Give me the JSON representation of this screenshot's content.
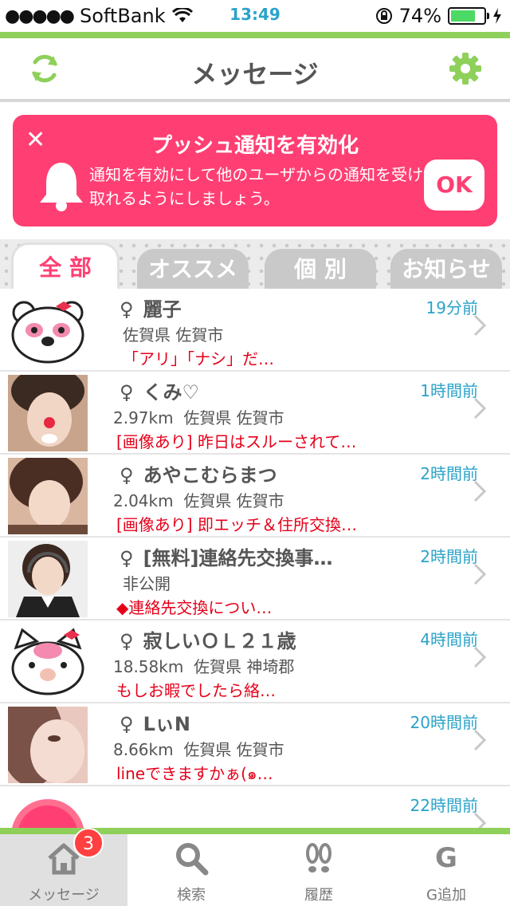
{
  "status": {
    "carrier": "SoftBank",
    "time": "13:49",
    "battery": "74%",
    "battery_level": 0.74
  },
  "header": {
    "title": "メッセージ",
    "refresh_icon": "refresh-icon",
    "settings_icon": "gear-icon"
  },
  "push": {
    "title": "プッシュ通知を有効化",
    "body": "通知を有効にして他のユーザからの通知を受け取れるようにしましょう。",
    "ok": "OK"
  },
  "tabs": [
    {
      "label": "全 部",
      "active": true
    },
    {
      "label": "オススメ",
      "active": false
    },
    {
      "label": "個 別",
      "active": false
    },
    {
      "label": "お知らせ",
      "active": false
    }
  ],
  "gender_symbol": "♀",
  "messages": [
    {
      "name": "麗子",
      "location": "佐賀県 佐賀市",
      "distance": "",
      "message": "「アリ」「ナシ」だ…",
      "time": "19分前",
      "avatar": "panda-icon"
    },
    {
      "name": "くみ♡",
      "location": "佐賀県 佐賀市",
      "distance": "2.97km",
      "message": "[画像あり] 昨日はスルーされて…",
      "time": "1時間前",
      "avatar": "photo"
    },
    {
      "name": "あやこむらまつ",
      "location": "佐賀県 佐賀市",
      "distance": "2.04km",
      "message": "[画像あり] 即エッチ＆住所交換…",
      "time": "2時間前",
      "avatar": "photo"
    },
    {
      "name": "[無料]連絡先交換事…",
      "location": "非公開",
      "distance": "",
      "message": "◆連絡先交換につい…",
      "time": "2時間前",
      "avatar": "photo"
    },
    {
      "name": "寂しいＯＬ２１歳",
      "location": "佐賀県 神埼郡",
      "distance": "18.58km",
      "message": "もしお暇でしたら絡…",
      "time": "4時間前",
      "avatar": "cat-icon"
    },
    {
      "name": "LぃN",
      "location": "佐賀県 佐賀市",
      "distance": "8.66km",
      "message": "lineできますかぁ(๑…",
      "time": "20時間前",
      "avatar": "photo"
    },
    {
      "name": "",
      "location": "",
      "distance": "",
      "message": "",
      "time": "22時間前",
      "avatar": "notice-icon"
    }
  ],
  "tabbar": {
    "items": [
      {
        "label": "メッセージ",
        "icon": "home-icon",
        "badge": "3"
      },
      {
        "label": "検索",
        "icon": "search-icon"
      },
      {
        "label": "履歴",
        "icon": "footprints-icon"
      },
      {
        "label": "G追加",
        "icon": "g-icon",
        "glyph": "G"
      }
    ]
  },
  "colors": {
    "accent_pink": "#ff3f73",
    "green": "#8ed05a",
    "time_blue": "#2aa3c9",
    "message_red": "#e5001a"
  }
}
